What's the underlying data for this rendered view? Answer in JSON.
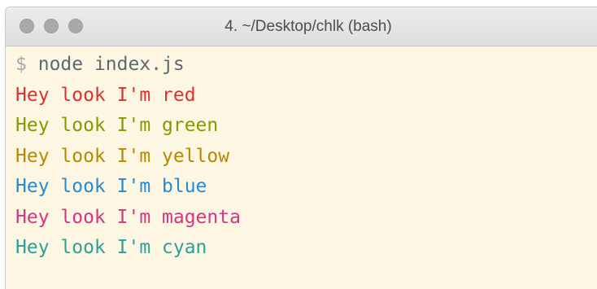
{
  "window": {
    "title": "4. ~/Desktop/chlk (bash)"
  },
  "terminal": {
    "prompt": "$",
    "command": "node index.js",
    "lines": [
      {
        "text": "Hey look I'm red",
        "color": "#dc322f"
      },
      {
        "text": "Hey look I'm green",
        "color": "#859900"
      },
      {
        "text": "Hey look I'm yellow",
        "color": "#b58900"
      },
      {
        "text": "Hey look I'm blue",
        "color": "#268bd2"
      },
      {
        "text": "Hey look I'm magenta",
        "color": "#d33682"
      },
      {
        "text": "Hey look I'm cyan",
        "color": "#2aa198"
      }
    ]
  },
  "colors": {
    "background": "#fdf6e3",
    "titlebar": "#e6e6e6",
    "traffic_light": "#a9a9a9"
  }
}
